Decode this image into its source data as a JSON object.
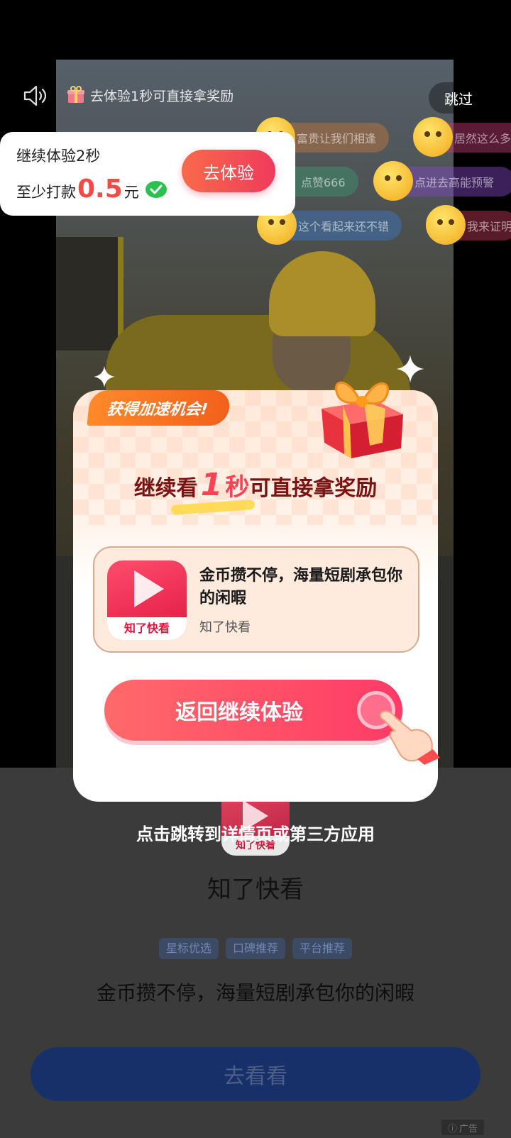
{
  "top_bar": {
    "tip": "去体验1秒可直接拿奖励",
    "skip_label": "跳过"
  },
  "danmaku": [
    "富贵让我们相逢",
    "居然这么多",
    "点赞666",
    "点进去高能预警",
    "这个看起来还不错",
    "我来证明"
  ],
  "reward_card": {
    "line1": "继续体验2秒",
    "line2_prefix": "至少打款",
    "amount": "0.5",
    "unit": "元",
    "button_label": "去体验"
  },
  "dialog": {
    "badge": "获得加速机会!",
    "headline_prefix": "继续看",
    "headline_number": "1",
    "headline_sec": "秒",
    "headline_suffix": "可直接拿奖励",
    "app_desc": "金币攒不停，海量短剧承包你的闲暇",
    "app_name": "知了快看",
    "app_icon_label": "知了快看",
    "return_button": "返回继续体验"
  },
  "redirect_text": "点击跳转到详情页或第三方应用",
  "ad_page": {
    "app_icon_label": "知了快看",
    "app_name": "知了快看",
    "tags": [
      "星标优选",
      "口碑推荐",
      "平台推荐"
    ],
    "slogan": "金币攒不停，海量短剧承包你的闲暇",
    "go_button": "去看看",
    "ad_badge": "广告"
  },
  "colors": {
    "accent_red": "#ff3a66",
    "amount_red": "#f24a47",
    "badge_orange": "#f2601b",
    "go_button_blue": "#18306a"
  }
}
